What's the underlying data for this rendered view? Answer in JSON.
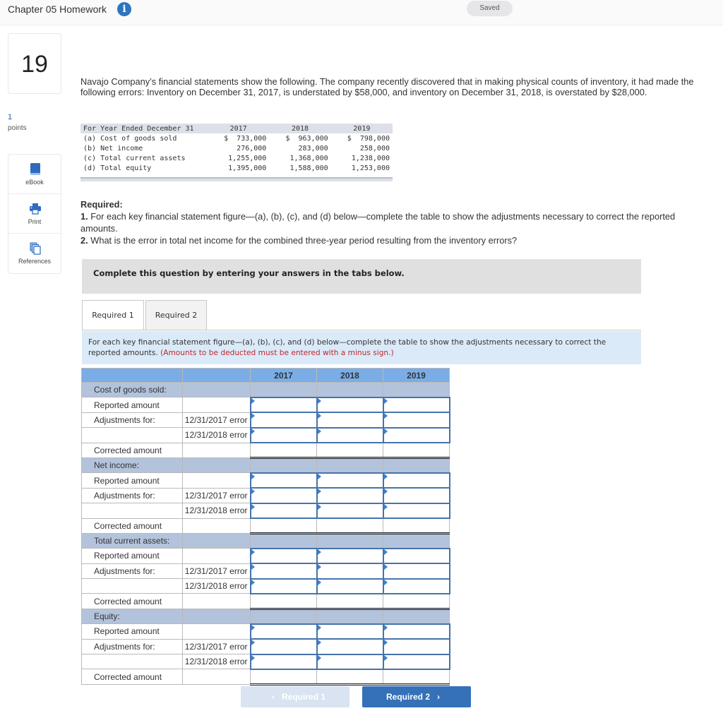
{
  "header": {
    "title": "Chapter 05 Homework",
    "info_icon": "info-circle-icon",
    "status": "Saved"
  },
  "question": {
    "number": "19",
    "points_value": "1",
    "points_label": "points"
  },
  "tools": [
    {
      "label": "eBook",
      "icon": "book-icon"
    },
    {
      "label": "Print",
      "icon": "printer-icon"
    },
    {
      "label": "References",
      "icon": "documents-stack-icon"
    }
  ],
  "problem": {
    "text": "Navajo Company’s financial statements show the following. The company recently discovered that in making physical counts of inventory, it had made the following errors: Inventory on December 31, 2017, is understated by $58,000, and inventory on December 31, 2018, is overstated by $28,000."
  },
  "given_table": {
    "header": [
      "For Year Ended December 31",
      "2017",
      "2018",
      "2019"
    ],
    "rows": [
      {
        "label": "(a) Cost of goods sold",
        "v2017": "$  733,000",
        "v2018": "$  963,000",
        "v2019": "$  798,000"
      },
      {
        "label": "(b) Net income",
        "v2017": "276,000",
        "v2018": "283,000",
        "v2019": "258,000"
      },
      {
        "label": "(c) Total current assets",
        "v2017": "1,255,000",
        "v2018": "1,368,000",
        "v2019": "1,238,000"
      },
      {
        "label": "(d) Total equity",
        "v2017": "1,395,000",
        "v2018": "1,588,000",
        "v2019": "1,253,000"
      }
    ]
  },
  "required": {
    "heading": "Required:",
    "item1_num": "1.",
    "item1_text": " For each key financial statement figure—(a), (b), (c), and (d) below—complete the table to show the adjustments necessary to correct the reported amounts.",
    "item2_num": "2.",
    "item2_text": " What is the error in total net income for the combined three-year period resulting from the inventory errors?"
  },
  "instruction_bar": "Complete this question by entering your answers in the tabs below.",
  "tabs": [
    {
      "label": "Required 1",
      "active": true
    },
    {
      "label": "Required 2",
      "active": false
    }
  ],
  "req1": {
    "instruction": "For each key financial statement figure—(a), (b), (c), and (d) below—complete the table to show the adjustments necessary to correct the reported amounts.",
    "note": "(Amounts to be deducted must be entered with a minus sign.)",
    "years": [
      "2017",
      "2018",
      "2019"
    ],
    "sections": [
      {
        "title": "Cost of goods sold:",
        "reported": "Reported amount",
        "adjust": "Adjustments for:",
        "err1": "12/31/2017 error",
        "err2": "12/31/2018 error",
        "corrected": "Corrected amount"
      },
      {
        "title": "Net income:",
        "reported": "Reported amount",
        "adjust": "Adjustments for:",
        "err1": "12/31/2017 error",
        "err2": "12/31/2018 error",
        "corrected": "Corrected amount"
      },
      {
        "title": "Total current assets:",
        "reported": "Reported amount",
        "adjust": "Adjustments for:",
        "err1": "12/31/2017 error",
        "err2": "12/31/2018 error",
        "corrected": "Corrected amount"
      },
      {
        "title": "Equity:",
        "reported": "Reported amount",
        "adjust": "Adjustments for:",
        "err1": "12/31/2017 error",
        "err2": "12/31/2018 error",
        "corrected": "Corrected amount"
      }
    ],
    "input_values": ""
  },
  "nav": {
    "prev_label": "Required 1",
    "prev_chevron": "‹",
    "next_label": "Required 2",
    "next_chevron": "›"
  },
  "colors": {
    "accent": "#3571b8",
    "year_header": "#7aade6",
    "section_row": "#b3c3dc",
    "note_red": "#c0272d"
  }
}
